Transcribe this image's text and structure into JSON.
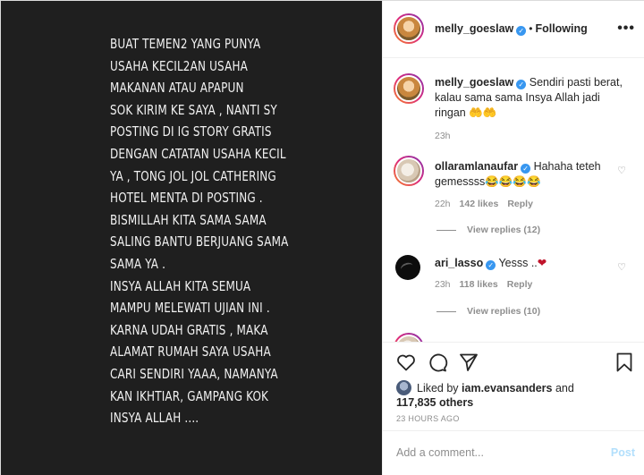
{
  "story": {
    "text": "BUAT TEMEN2 YANG PUNYA\nUSAHA KECIL2AN USAHA\nMAKANAN ATAU APAPUN\nSOK KIRIM KE SAYA , NANTI SY\nPOSTING DI IG STORY GRATIS\nDENGAN CATATAN USAHA KECIL\nYA , TONG JOL JOL CATHERING\nHOTEL MENTA DI POSTING .\nBISMILLAH KITA SAMA SAMA\nSALING BANTU BERJUANG SAMA\nSAMA YA .\nINSYA ALLAH KITA SEMUA\nMAMPU MELEWATI UJIAN INI .\nKARNA UDAH GRATIS , MAKA\nALAMAT RUMAH SAYA USAHA\nCARI SENDIRI YAAA, NAMANYA\nKAN IKHTIAR, GAMPANG KOK\nINSYA ALLAH ...."
  },
  "header": {
    "username": "melly_goeslaw",
    "separator": "•",
    "follow_status": "Following",
    "more": "•••"
  },
  "caption": {
    "username": "melly_goeslaw",
    "text": "Sendiri pasti berat, kalau sama sama Insya Allah jadi ringan 🤲🤲",
    "time": "23h"
  },
  "comments": [
    {
      "username": "ollaramlanaufar",
      "text": "Hahaha teteh gemessss😂😂😂😂",
      "time": "22h",
      "likes": "142 likes",
      "reply": "Reply",
      "view_replies": "View replies (12)"
    },
    {
      "username": "ari_lasso",
      "text": "Yesss ..",
      "heart": "❤",
      "time": "23h",
      "likes": "118 likes",
      "reply": "Reply",
      "view_replies": "View replies (10)"
    }
  ],
  "likes": {
    "prefix": "Liked by",
    "user": "iam.evansanders",
    "and": "and",
    "others": "117,835 others"
  },
  "timestamp": "23 HOURS AGO",
  "add_comment": {
    "placeholder": "Add a comment...",
    "post": "Post"
  },
  "colors": {
    "verified": "#3897f0",
    "story_bg": "#1f1f1f",
    "post_disabled": "#b2dffc"
  }
}
